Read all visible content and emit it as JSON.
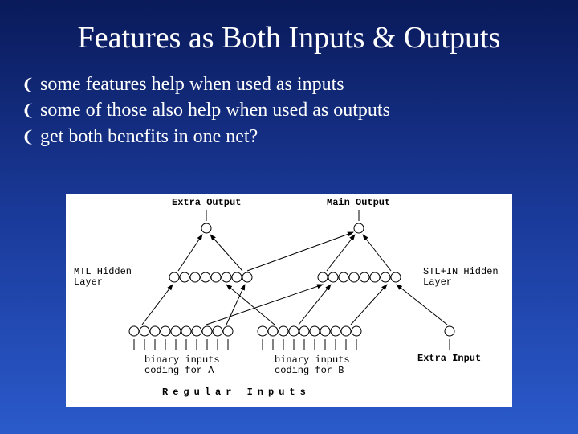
{
  "title": "Features as Both Inputs & Outputs",
  "bullets": {
    "b1": "some features help when used as inputs",
    "b2": "some of those also help when used as outputs",
    "b3": "get both benefits in one net?"
  },
  "diagram": {
    "extra_output": "Extra Output",
    "main_output": "Main Output",
    "mtl_hidden": "MTL Hidden\nLayer",
    "stl_hidden": "STL+IN Hidden\nLayer",
    "binary_a": "binary inputs\ncoding for A",
    "binary_b": "binary inputs\ncoding for B",
    "extra_input": "Extra Input",
    "regular_inputs": "Regular Inputs"
  }
}
